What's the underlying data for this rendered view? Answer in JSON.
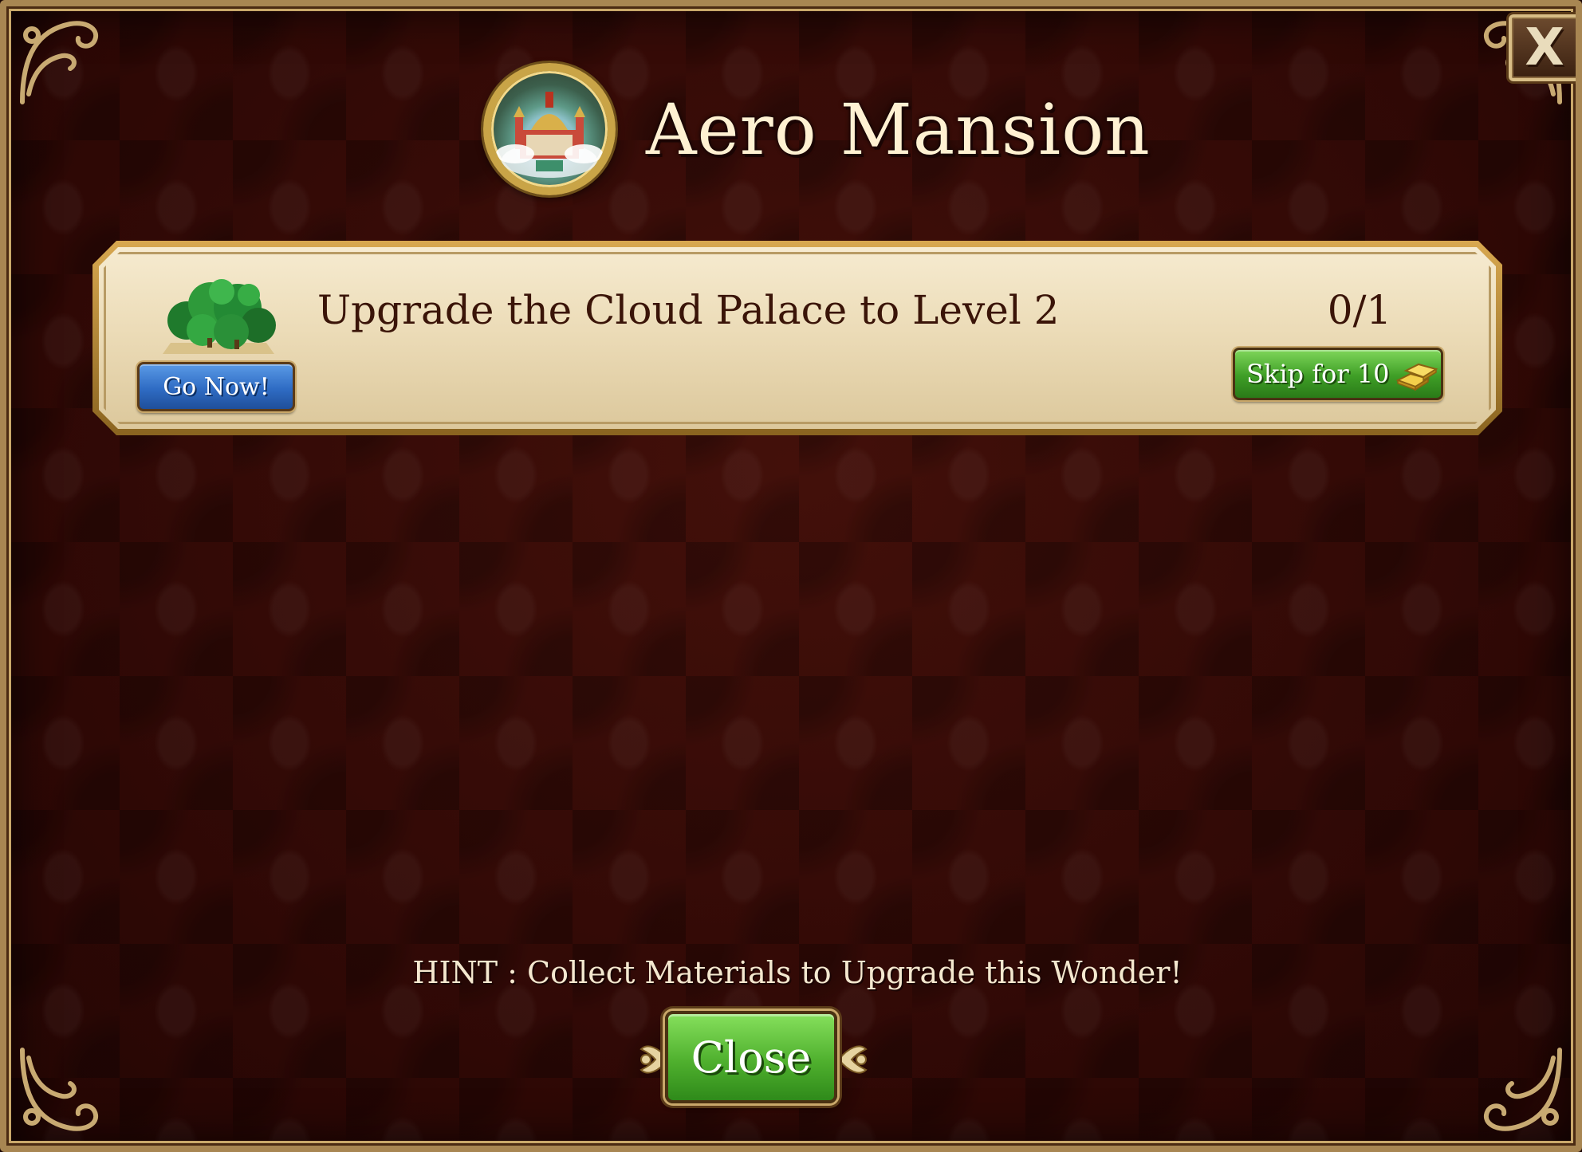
{
  "dialog": {
    "title": "Aero Mansion",
    "close_icon_glyph": "X",
    "medallion_icon": "aero-mansion-building-icon"
  },
  "quest": {
    "icon": "cloud-palace-trees-icon",
    "go_label": "Go Now!",
    "text": "Upgrade the Cloud Palace to Level 2",
    "progress": "0/1",
    "skip_label": "Skip for 10",
    "skip_currency_icon": "gold-bars-icon"
  },
  "footer": {
    "hint": "HINT : Collect Materials to Upgrade this Wonder!",
    "close_label": "Close"
  },
  "colors": {
    "background": "#350b07",
    "panel": "#ecdcb8",
    "go_button": "#2f6cc4",
    "skip_button": "#3e9e26",
    "close_button": "#4fb02e",
    "title_text": "#fff1d2"
  }
}
